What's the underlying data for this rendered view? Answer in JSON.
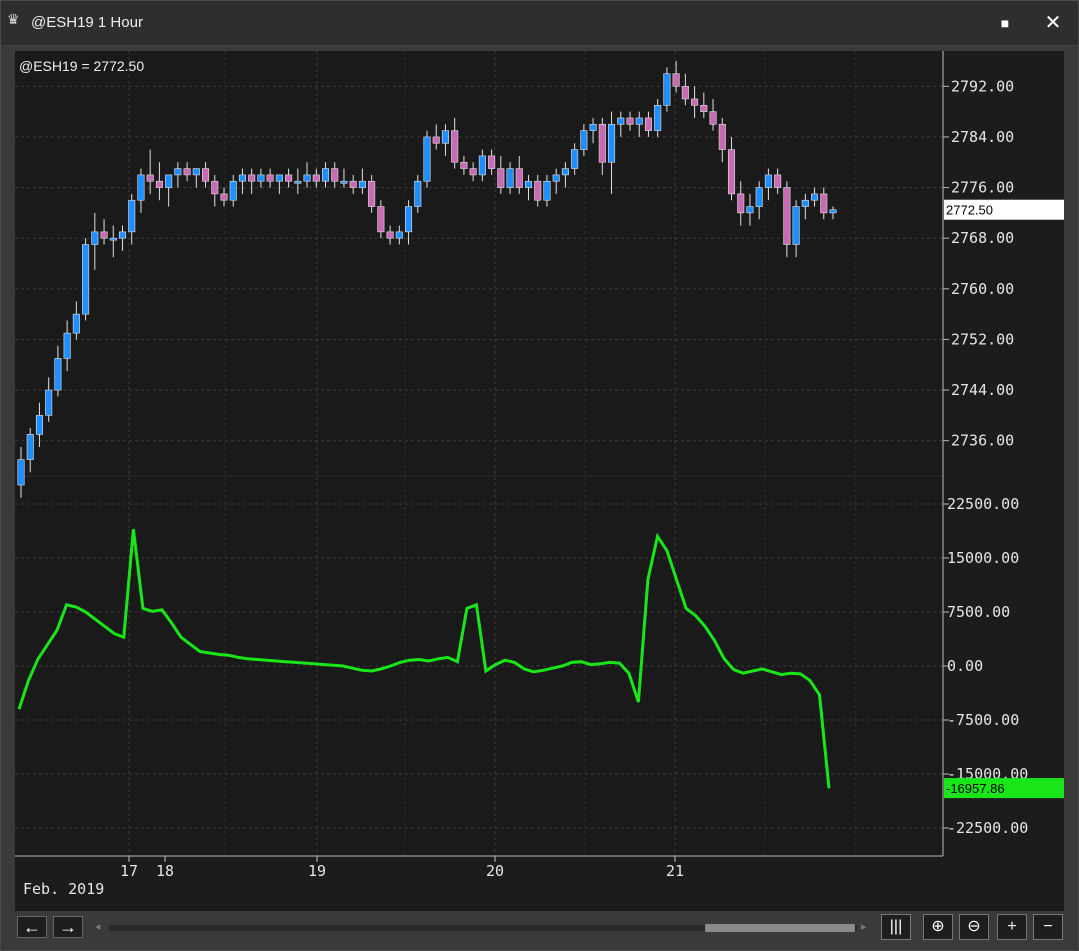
{
  "window": {
    "title": "@ESH19 1 Hour",
    "icon": "chart-app-icon"
  },
  "price_pane": {
    "label": "@ESH19 = 2772.50",
    "last_value": "2772.50",
    "last_value_bg": "#ffffff",
    "y_ticks": [
      "2792.00",
      "2784.00",
      "2776.00",
      "2768.00",
      "2760.00",
      "2752.00",
      "2744.00",
      "2736.00"
    ],
    "up_color": "#1f8fff",
    "down_color": "#c86ab4"
  },
  "indicator_pane": {
    "last_value": "-16957.86",
    "line_color": "#19e619",
    "y_ticks": [
      "22500.00",
      "15000.00",
      "7500.00",
      "0.00",
      "-7500.00",
      "-15000.00",
      "-22500.00"
    ]
  },
  "x_axis": {
    "labels": [
      "17",
      "18",
      "19",
      "20",
      "21"
    ],
    "month_label": "Feb. 2019"
  },
  "chart_data": [
    {
      "type": "candlestick",
      "series_name": "@ESH19",
      "ylim": [
        2732,
        2796
      ],
      "bars": [
        [
          2729,
          2735,
          2727,
          2733
        ],
        [
          2733,
          2738,
          2731,
          2737
        ],
        [
          2737,
          2742,
          2735,
          2740
        ],
        [
          2740,
          2746,
          2739,
          2744
        ],
        [
          2744,
          2751,
          2743,
          2749
        ],
        [
          2749,
          2755,
          2747,
          2753
        ],
        [
          2753,
          2758,
          2752,
          2756
        ],
        [
          2756,
          2768,
          2755,
          2767
        ],
        [
          2767,
          2772,
          2763,
          2769
        ],
        [
          2769,
          2771,
          2767,
          2768
        ],
        [
          2768,
          2770,
          2765,
          2768
        ],
        [
          2768,
          2770,
          2766,
          2769
        ],
        [
          2769,
          2775,
          2767,
          2774
        ],
        [
          2774,
          2779,
          2772,
          2778
        ],
        [
          2778,
          2782,
          2775,
          2777
        ],
        [
          2777,
          2780,
          2774,
          2776
        ],
        [
          2776,
          2778,
          2773,
          2778
        ],
        [
          2778,
          2780,
          2776,
          2779
        ],
        [
          2779,
          2780,
          2777,
          2778
        ],
        [
          2778,
          2779,
          2776,
          2779
        ],
        [
          2779,
          2780,
          2776,
          2777
        ],
        [
          2777,
          2778,
          2773,
          2775
        ],
        [
          2775,
          2776,
          2773,
          2774
        ],
        [
          2774,
          2778,
          2773,
          2777
        ],
        [
          2777,
          2779,
          2775,
          2778
        ],
        [
          2778,
          2779,
          2775,
          2777
        ],
        [
          2777,
          2779,
          2776,
          2778
        ],
        [
          2778,
          2779,
          2776,
          2777
        ],
        [
          2777,
          2778,
          2775,
          2778
        ],
        [
          2778,
          2779,
          2776,
          2777
        ],
        [
          2777,
          2779,
          2775,
          2777
        ],
        [
          2777,
          2780,
          2776,
          2778
        ],
        [
          2778,
          2779,
          2776,
          2777
        ],
        [
          2777,
          2780,
          2776,
          2779
        ],
        [
          2779,
          2780,
          2776,
          2777
        ],
        [
          2777,
          2779,
          2776,
          2777
        ],
        [
          2777,
          2778,
          2775,
          2776
        ],
        [
          2776,
          2779,
          2775,
          2777
        ],
        [
          2777,
          2778,
          2772,
          2773
        ],
        [
          2773,
          2774,
          2768,
          2769
        ],
        [
          2769,
          2770,
          2767,
          2768
        ],
        [
          2768,
          2770,
          2767,
          2769
        ],
        [
          2769,
          2774,
          2767,
          2773
        ],
        [
          2773,
          2778,
          2772,
          2777
        ],
        [
          2777,
          2785,
          2776,
          2784
        ],
        [
          2784,
          2786,
          2782,
          2783
        ],
        [
          2783,
          2786,
          2781,
          2785
        ],
        [
          2785,
          2787,
          2779,
          2780
        ],
        [
          2780,
          2781,
          2778,
          2779
        ],
        [
          2779,
          2780,
          2777,
          2778
        ],
        [
          2778,
          2782,
          2777,
          2781
        ],
        [
          2781,
          2782,
          2778,
          2779
        ],
        [
          2779,
          2781,
          2775,
          2776
        ],
        [
          2776,
          2780,
          2775,
          2779
        ],
        [
          2779,
          2781,
          2775,
          2776
        ],
        [
          2776,
          2778,
          2774,
          2777
        ],
        [
          2777,
          2778,
          2773,
          2774
        ],
        [
          2774,
          2778,
          2773,
          2777
        ],
        [
          2777,
          2779,
          2775,
          2778
        ],
        [
          2778,
          2780,
          2776,
          2779
        ],
        [
          2779,
          2783,
          2778,
          2782
        ],
        [
          2782,
          2786,
          2781,
          2785
        ],
        [
          2785,
          2787,
          2783,
          2786
        ],
        [
          2786,
          2787,
          2778,
          2780
        ],
        [
          2780,
          2788,
          2775,
          2786
        ],
        [
          2786,
          2788,
          2784,
          2787
        ],
        [
          2787,
          2788,
          2785,
          2786
        ],
        [
          2786,
          2788,
          2784,
          2787
        ],
        [
          2787,
          2788,
          2784,
          2785
        ],
        [
          2785,
          2790,
          2784,
          2789
        ],
        [
          2789,
          2795,
          2788,
          2794
        ],
        [
          2794,
          2796,
          2791,
          2792
        ],
        [
          2792,
          2794,
          2789,
          2790
        ],
        [
          2790,
          2792,
          2787,
          2789
        ],
        [
          2789,
          2791,
          2787,
          2788
        ],
        [
          2788,
          2790,
          2785,
          2786
        ],
        [
          2786,
          2787,
          2780,
          2782
        ],
        [
          2782,
          2784,
          2774,
          2775
        ],
        [
          2775,
          2777,
          2770,
          2772
        ],
        [
          2772,
          2775,
          2770,
          2773
        ],
        [
          2773,
          2777,
          2771,
          2776
        ],
        [
          2776,
          2779,
          2774,
          2778
        ],
        [
          2778,
          2779,
          2775,
          2776
        ],
        [
          2776,
          2777,
          2765,
          2767
        ],
        [
          2767,
          2774,
          2765,
          2773
        ],
        [
          2773,
          2775,
          2771,
          2774
        ],
        [
          2774,
          2776,
          2773,
          2775
        ],
        [
          2775,
          2776,
          2771,
          2772
        ],
        [
          2772,
          2773,
          2771,
          2772.5
        ]
      ]
    },
    {
      "type": "line",
      "ylim": [
        -25000,
        25000
      ],
      "values": [
        -6000,
        -2000,
        1000,
        3000,
        5000,
        8500,
        8200,
        7500,
        6500,
        5500,
        4500,
        4000,
        19000,
        8000,
        7600,
        7800,
        6000,
        4000,
        3000,
        2000,
        1800,
        1600,
        1500,
        1200,
        1000,
        900,
        800,
        700,
        600,
        500,
        400,
        300,
        200,
        100,
        0,
        -300,
        -600,
        -700,
        -400,
        0,
        500,
        800,
        900,
        700,
        1000,
        1200,
        600,
        8000,
        8500,
        -700,
        200,
        800,
        500,
        -400,
        -800,
        -600,
        -300,
        0,
        500,
        600,
        200,
        300,
        500,
        400,
        -1000,
        -5000,
        12000,
        18000,
        16000,
        12000,
        8000,
        7000,
        5500,
        3500,
        1000,
        -500,
        -1000,
        -700,
        -400,
        -800,
        -1200,
        -1000,
        -1100,
        -2000,
        -4000,
        -17000
      ]
    }
  ]
}
